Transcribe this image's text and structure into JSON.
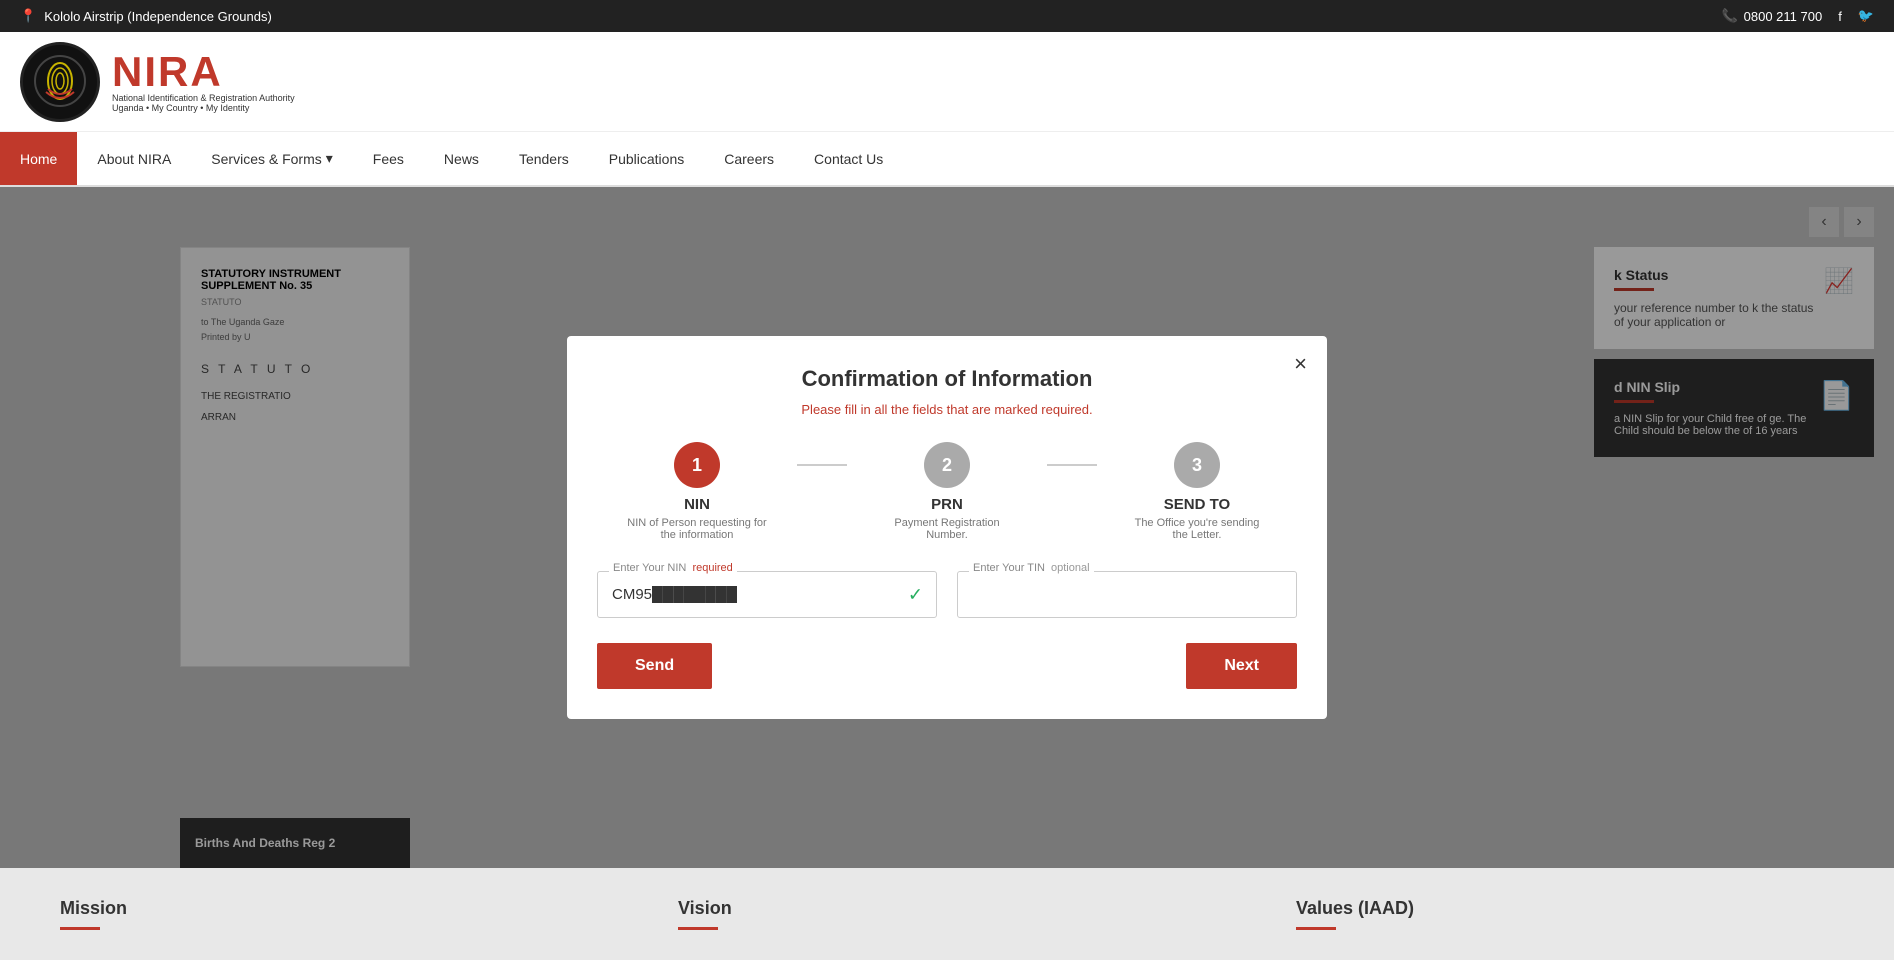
{
  "topbar": {
    "location": "Kololo Airstrip (Independence Grounds)",
    "phone": "0800 211 700"
  },
  "nav": {
    "items": [
      {
        "label": "Home",
        "active": true
      },
      {
        "label": "About NIRA",
        "active": false
      },
      {
        "label": "Services & Forms",
        "active": false
      },
      {
        "label": "Fees",
        "active": false
      },
      {
        "label": "News",
        "active": false
      },
      {
        "label": "Tenders",
        "active": false
      },
      {
        "label": "Publications",
        "active": false
      },
      {
        "label": "Careers",
        "active": false
      },
      {
        "label": "Contact Us",
        "active": false
      }
    ]
  },
  "modal": {
    "title": "Confirmation of Information",
    "subtitle": "Please fill in all the fields that are marked required.",
    "close_label": "×",
    "steps": [
      {
        "number": "1",
        "label": "NIN",
        "desc": "NIN of Person requesting for the information",
        "active": true
      },
      {
        "number": "2",
        "label": "PRN",
        "desc": "Payment Registration Number.",
        "active": false
      },
      {
        "number": "3",
        "label": "SEND TO",
        "desc": "The Office you're sending the Letter.",
        "active": false
      }
    ],
    "nin_field": {
      "label": "Enter Your NIN",
      "required_label": "required",
      "value": "CM95"
    },
    "tin_field": {
      "label": "Enter Your TIN",
      "optional_label": "optional",
      "placeholder": ""
    },
    "send_button": "Send",
    "next_button": "Next"
  },
  "background": {
    "document_title": "STATUTORY INSTRUMENT SUPPLEMENT No. 35",
    "document_subtitle": "STATUTO",
    "document_text": "to The Uganda Gaze",
    "document_printed": "Printed by U",
    "statutes_text": "S T A T U T O",
    "reg_text": "THE REGISTRATIO",
    "arrang_text": "ARRAN",
    "births_deaths": "Births And Deaths Reg 2",
    "track_title": "k Status",
    "track_line_text": "your reference number to k the status of your application or",
    "nin_slip_title": "d NIN Slip",
    "nin_slip_text": "a NIN Slip for your Child free of ge. The Child should be below the of 16 years"
  },
  "footer": {
    "mission_title": "Mission",
    "vision_title": "Vision",
    "values_title": "Values (IAAD)"
  }
}
